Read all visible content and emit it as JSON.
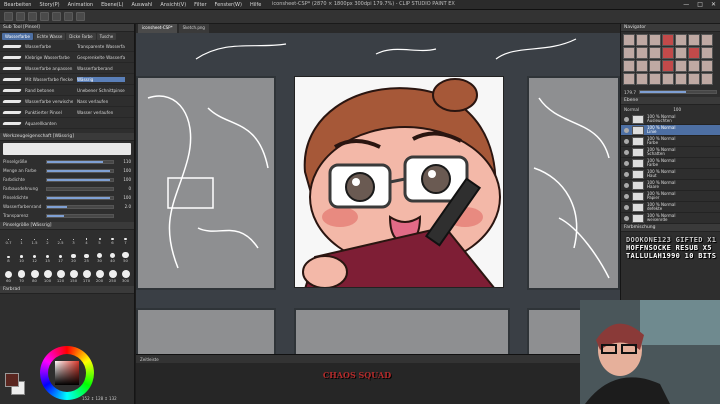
{
  "window": {
    "title": "iconsheet-CSP* (2870 × 1800px 300dpi 179.7%) - CLIP STUDIO PAINT EX",
    "menu": [
      "Bearbeiten",
      "Story(P)",
      "Animation",
      "Ebene(L)",
      "Auswahl",
      "Ansicht(V)",
      "Filter",
      "Fenster(W)",
      "Hilfe"
    ],
    "controls": [
      "—",
      "□",
      "✕"
    ]
  },
  "canvas_tabs": [
    {
      "label": "iconsheet-CSP*",
      "active": true
    },
    {
      "label": "Sketch.png",
      "active": false
    }
  ],
  "left_panel": {
    "brush_tab_title": "Sub Tool [Pinsel]",
    "subtabs": [
      {
        "label": "Wasserfarbe",
        "active": true
      },
      {
        "label": "Echte Wasse",
        "active": false
      },
      {
        "label": "Dicke Farbe",
        "active": false
      },
      {
        "label": "Tusche",
        "active": false
      }
    ],
    "brushes": [
      {
        "left": "Wasserfarbe",
        "right": "Transparente Wasserfarbe",
        "active": false
      },
      {
        "left": "Klebrige Wasserfarbe",
        "right": "Gesprenkelte Wasserfarbe",
        "active": false
      },
      {
        "left": "Wasserfarbe anpassen",
        "right": "Wasserfarberand",
        "active": false
      },
      {
        "left": "Mit Wasserfarbe fleckend",
        "right": "Wässrig",
        "active": true
      },
      {
        "left": "Rand betonen",
        "right": "Unebener Schnittpinsel",
        "active": false
      },
      {
        "left": "Wasserfarbe verwischen",
        "right": "Nass verlaufen",
        "active": false
      },
      {
        "left": "Punktierter Pinsel",
        "right": "Wasser verlaufen",
        "active": false
      },
      {
        "left": "Aquarellkanten",
        "right": "",
        "active": false
      }
    ],
    "tool_property_title": "Werkzeugeigenschaft [Wässrig]",
    "properties": [
      {
        "label": "Pinselgröße",
        "value": "110",
        "fill": 0.85
      },
      {
        "label": "Menge an Farbe",
        "value": "100",
        "fill": 0.95
      },
      {
        "label": "Farbdichte",
        "value": "100",
        "fill": 0.95
      },
      {
        "label": "Farbausdehnung",
        "value": "0",
        "fill": 0.0
      },
      {
        "label": "Pinseldichte",
        "value": "100",
        "fill": 0.95
      },
      {
        "label": "Wasserfarbenrand",
        "value": "2.0",
        "fill": 0.3
      },
      {
        "label": "Transparenz",
        "value": "",
        "fill": 0.25
      }
    ],
    "brush_size_title": "Pinselgröße [Wässrig]",
    "sizes": [
      "0.7",
      "1",
      "1.5",
      "2",
      "2.5",
      "3",
      "4",
      "5",
      "6",
      "7",
      "8",
      "10",
      "12",
      "15",
      "17",
      "20",
      "25",
      "30",
      "40",
      "50",
      "60",
      "70",
      "80",
      "100",
      "120",
      "150",
      "170",
      "200",
      "250",
      "300"
    ],
    "color_title": "Farbrad"
  },
  "right_panel": {
    "navigator_title": "Navigator",
    "zoom": "179.7",
    "layer_title": "Ebene",
    "blend_mode": "Normal",
    "opacity": "100",
    "layers": [
      {
        "name": "100 % Normal\nAusleuchten",
        "selected": false
      },
      {
        "name": "100 % Normal\nLinie",
        "selected": true
      },
      {
        "name": "100 % Normal\nFarbe",
        "selected": false
      },
      {
        "name": "100 % Normal\nSchatten",
        "selected": false
      },
      {
        "name": "100 % Normal\nFarbe",
        "selected": false
      },
      {
        "name": "100 % Normal\nHaut",
        "selected": false
      },
      {
        "name": "100 % Normal\nHaare",
        "selected": false
      },
      {
        "name": "100 % Normal\nPapier",
        "selected": false
      },
      {
        "name": "100 % Normal\ndefekte",
        "selected": false
      },
      {
        "name": "100 % Normal\nweisenrde",
        "selected": false
      }
    ],
    "palette_title": "Farbmischung"
  },
  "alerts": [
    "DOOKONE123 GIFTED X1",
    "HOFFNSOCKE RESUB X5",
    "TALLULAH1990 10 BITS"
  ],
  "status": {
    "color_values": "152 ↕ 128 ↕ 132"
  },
  "timeline_title": "Zeitleiste",
  "stream_logo": "CHAOS SQUAD",
  "colors": {
    "accent": "#4d6fa3",
    "foreground": "#5a2620",
    "background": "#eeeeee"
  }
}
